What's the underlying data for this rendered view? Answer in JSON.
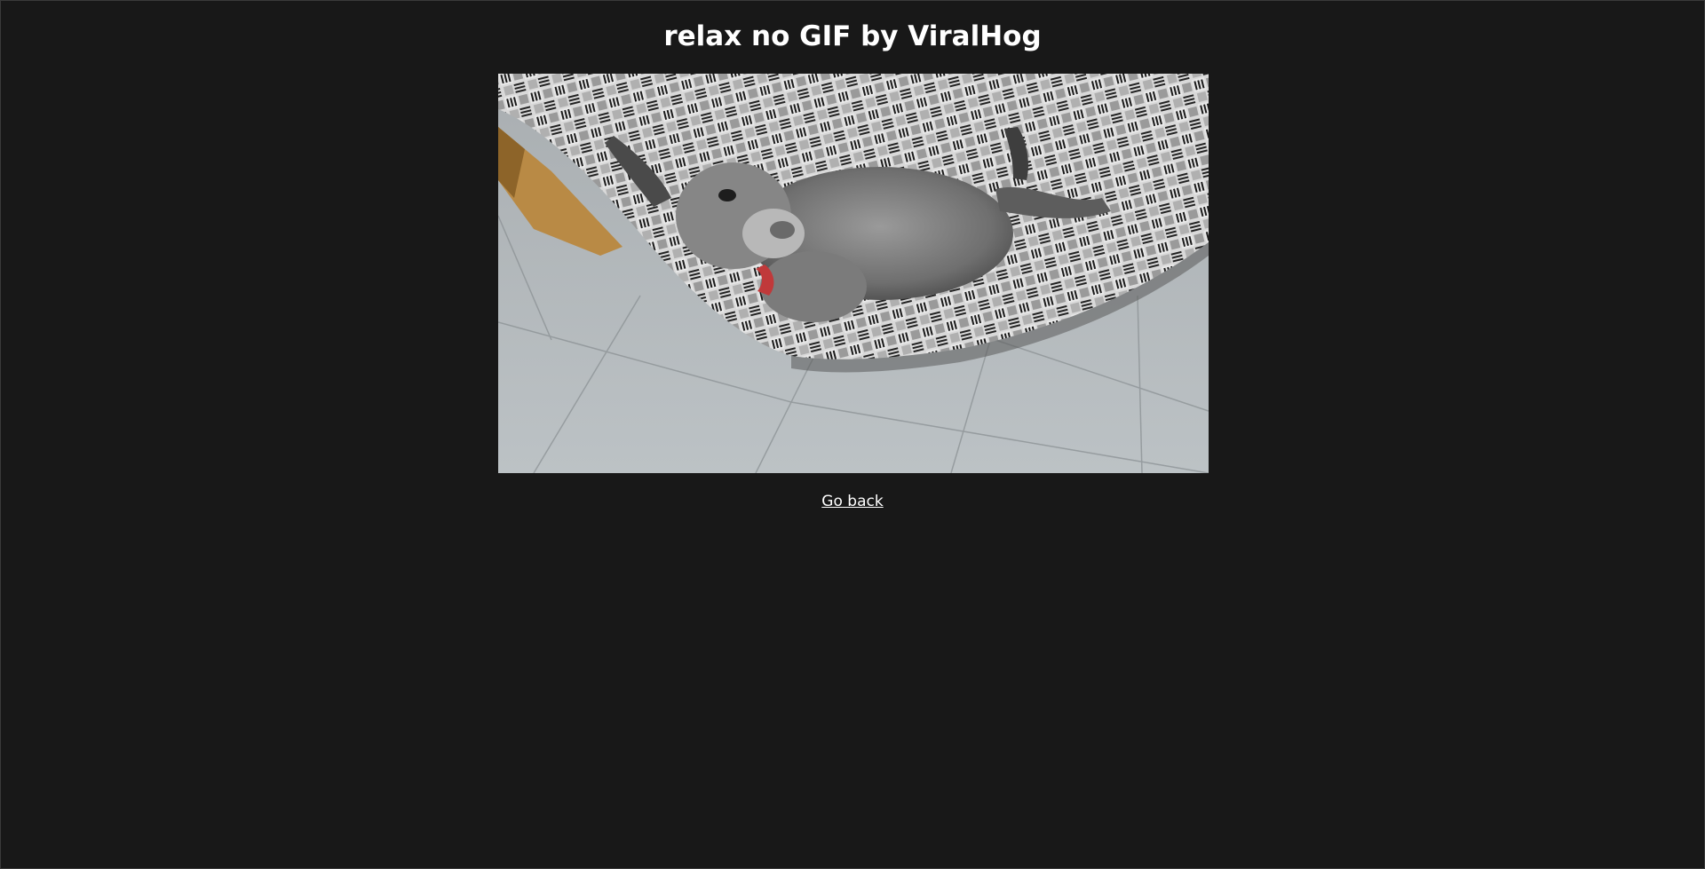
{
  "page": {
    "title": "relax no GIF by ViralHog",
    "background": "#181818"
  },
  "gif": {
    "subject": "baby donkey lying in a patterned hammock over a tiled floor"
  },
  "nav": {
    "back_label": "Go back"
  }
}
